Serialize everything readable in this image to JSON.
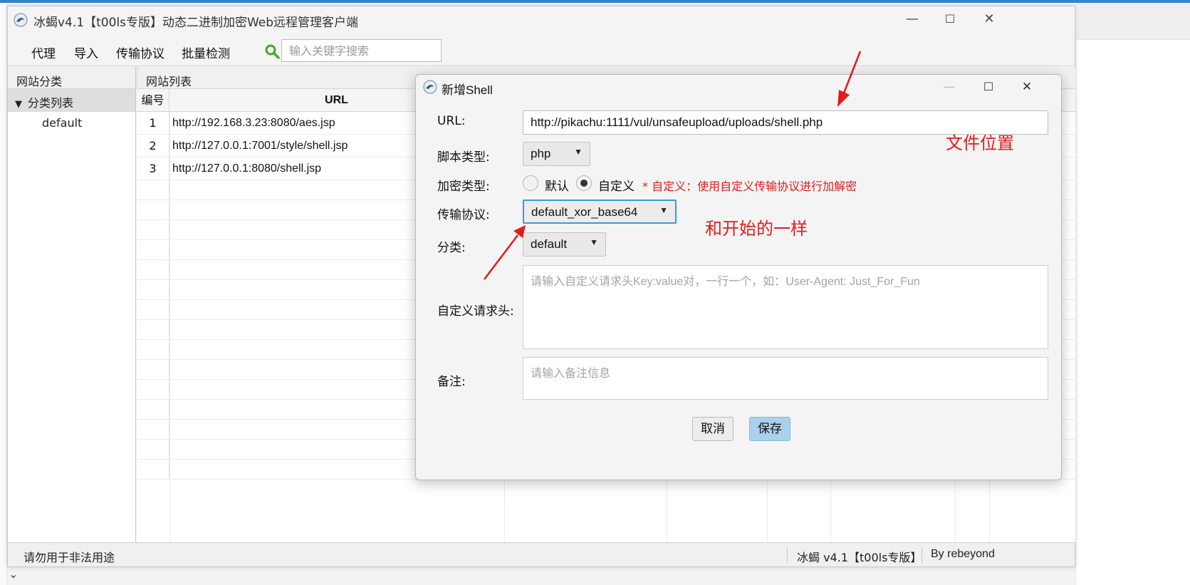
{
  "app": {
    "title": "冰蝎v4.1【t00ls专版】动态二进制加密Web远程管理客户端",
    "window_controls": {
      "minimize": "—",
      "maximize": "☐",
      "close": "✕"
    }
  },
  "menu": {
    "items": [
      "代理",
      "导入",
      "传输协议",
      "批量检测"
    ],
    "search_placeholder": "输入关键字搜索"
  },
  "sidebar": {
    "header": "网站分类",
    "tree_root": "分类列表",
    "tree_children": [
      "default"
    ]
  },
  "site_list": {
    "header": "网站列表",
    "columns": {
      "num": "编号",
      "url": "URL"
    },
    "rows": [
      {
        "num": "1",
        "url": "http://192.168.3.23:8080/aes.jsp"
      },
      {
        "num": "2",
        "url": "http://127.0.0.1:7001/style/shell.jsp"
      },
      {
        "num": "3",
        "url": "http://127.0.0.1:8080/shell.jsp"
      }
    ]
  },
  "status": {
    "left": "请勿用于非法用途",
    "version": "冰蝎 v4.1【t00ls专版】",
    "author": "By rebeyond"
  },
  "dialog": {
    "title": "新增Shell",
    "labels": {
      "url": "URL:",
      "script_type": "脚本类型:",
      "encrypt_type": "加密类型:",
      "protocol": "传输协议:",
      "category": "分类:",
      "headers": "自定义请求头:",
      "remark": "备注:"
    },
    "url_value": "http://pikachu:1111/vul/unsafeupload/uploads/shell.php",
    "script_type_value": "php",
    "encrypt_options": {
      "default": "默认",
      "custom": "自定义",
      "selected": "custom"
    },
    "encrypt_note": "* 自定义：使用自定义传输协议进行加解密",
    "protocol_value": "default_xor_base64",
    "category_value": "default",
    "headers_placeholder": "请输入自定义请求头Key:value对，一行一个，如：User-Agent: Just_For_Fun",
    "remark_placeholder": "请输入备注信息",
    "buttons": {
      "cancel": "取消",
      "save": "保存"
    }
  },
  "annotations": {
    "file_location": "文件位置",
    "same_as_start": "和开始的一样",
    "color": "#e31b1b"
  }
}
